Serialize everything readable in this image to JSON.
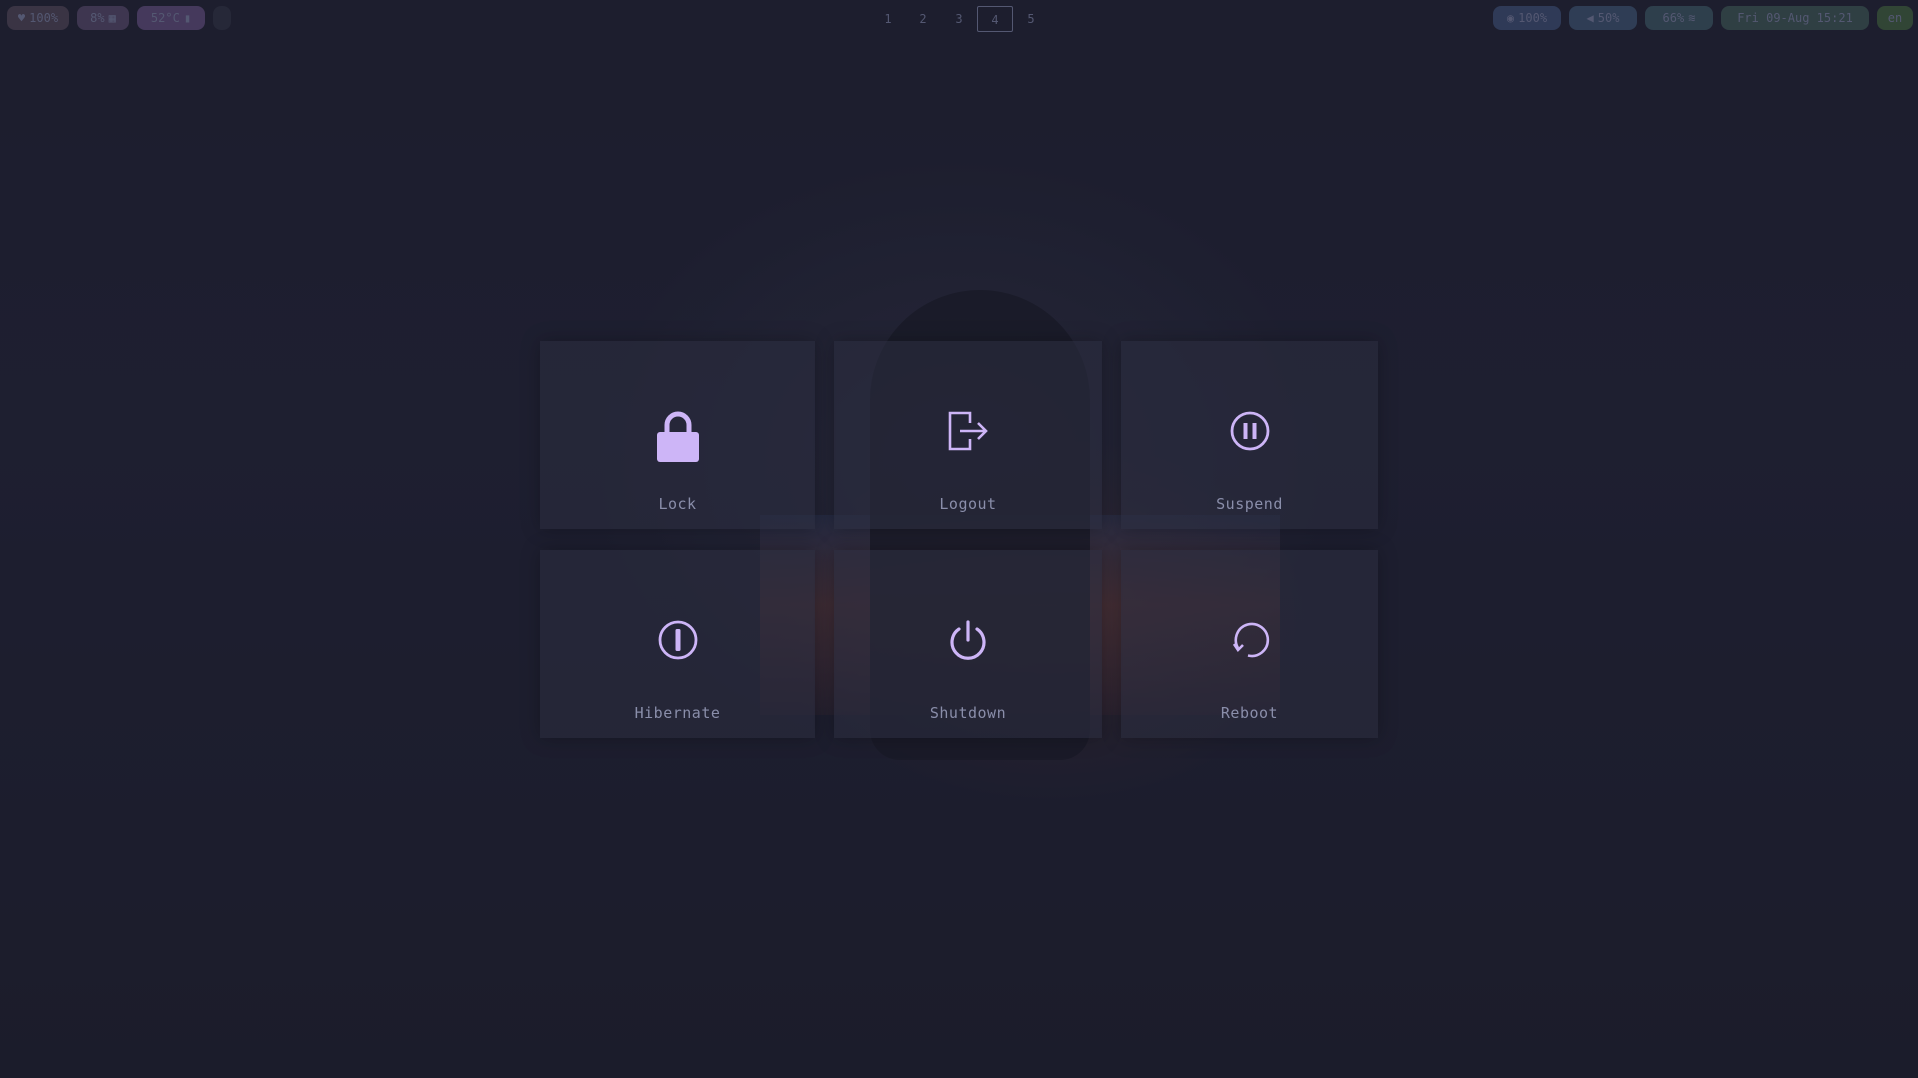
{
  "topbar": {
    "left": {
      "battery": {
        "icon": "heart-icon",
        "text": "100%"
      },
      "cpu": {
        "icon": "chip-icon",
        "text": "8%"
      },
      "temperature": {
        "icon": "thermometer-icon",
        "text": "52°C"
      }
    },
    "workspaces": [
      "1",
      "2",
      "3",
      "4",
      "5"
    ],
    "active_workspace": "4",
    "right": {
      "brightness": {
        "icon": "bulb-icon",
        "text": "100%"
      },
      "volume": {
        "icon": "speaker-icon",
        "text": "50%"
      },
      "wifi": {
        "icon": "wifi-icon",
        "text": "66%"
      },
      "clock": "Fri 09-Aug 15:21",
      "language": "en"
    }
  },
  "power_menu": {
    "lock": {
      "label": "Lock",
      "icon": "lock-icon"
    },
    "logout": {
      "label": "Logout",
      "icon": "logout-icon"
    },
    "suspend": {
      "label": "Suspend",
      "icon": "pause-circle-icon"
    },
    "hibernate": {
      "label": "Hibernate",
      "icon": "hibernate-icon"
    },
    "shutdown": {
      "label": "Shutdown",
      "icon": "power-icon"
    },
    "reboot": {
      "label": "Reboot",
      "icon": "reboot-icon"
    }
  },
  "colors": {
    "icon_accent": "#cdb5f7",
    "pill_battery": "#3a3444",
    "pill_cpu": "#3e3650",
    "pill_temp": "#45395c",
    "pill_brightness": "#2f3a57",
    "pill_volume": "#2f3d55",
    "pill_wifi": "#2e3f4c",
    "pill_clock": "#2f3f43",
    "pill_lang": "#314535"
  }
}
